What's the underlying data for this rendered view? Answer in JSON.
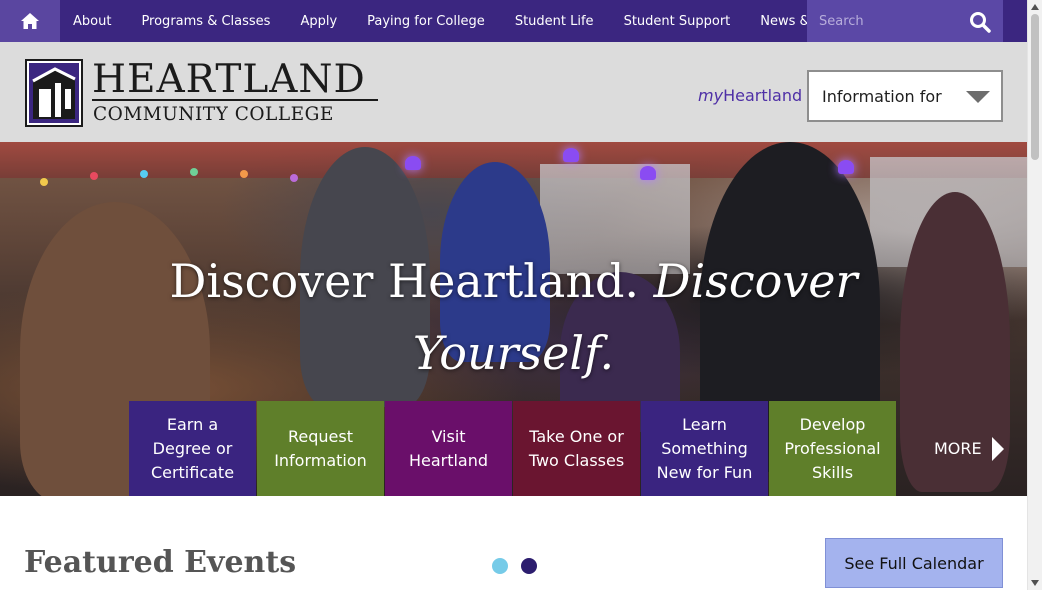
{
  "topnav": {
    "home_icon": "home-icon",
    "items": [
      {
        "label": "About"
      },
      {
        "label": "Programs & Classes"
      },
      {
        "label": "Apply"
      },
      {
        "label": "Paying for College"
      },
      {
        "label": "Student Life"
      },
      {
        "label": "Student Support"
      },
      {
        "label": "News & Calendar"
      }
    ],
    "search": {
      "placeholder": "Search",
      "icon": "search-icon"
    },
    "colors": {
      "bar": "#3b2680",
      "home": "#5a46a0",
      "search": "#5b48a6"
    }
  },
  "header": {
    "logo": {
      "line1": "HEARTLAND",
      "line2": "COMMUNITY COLLEGE"
    },
    "my_heartland": {
      "prefix": "my",
      "name": "Heartland"
    },
    "info_select": {
      "selected": "Information for"
    }
  },
  "hero": {
    "title_part1": "Discover Heartland. ",
    "title_part2_italic": "Discover",
    "title_line2_italic": "Yourself.",
    "tiles": [
      {
        "label": "Earn a Degree or Certificate",
        "color": "#3a2480"
      },
      {
        "label": "Request Information",
        "color": "#5f7f2a"
      },
      {
        "label": "Visit Heartland",
        "color": "#6a0f6a"
      },
      {
        "label": "Take One or Two Classes",
        "color": "#6a1530"
      },
      {
        "label": "Learn Something New for Fun",
        "color": "#3a2480"
      },
      {
        "label": "Develop Professional Skills",
        "color": "#5f7f2a"
      }
    ],
    "more_label": "MORE"
  },
  "featured": {
    "title": "Featured Events",
    "dots": [
      {
        "color": "#76cbe8",
        "active": false
      },
      {
        "color": "#2c1d6e",
        "active": true
      }
    ],
    "calendar_button": "See Full Calendar"
  }
}
